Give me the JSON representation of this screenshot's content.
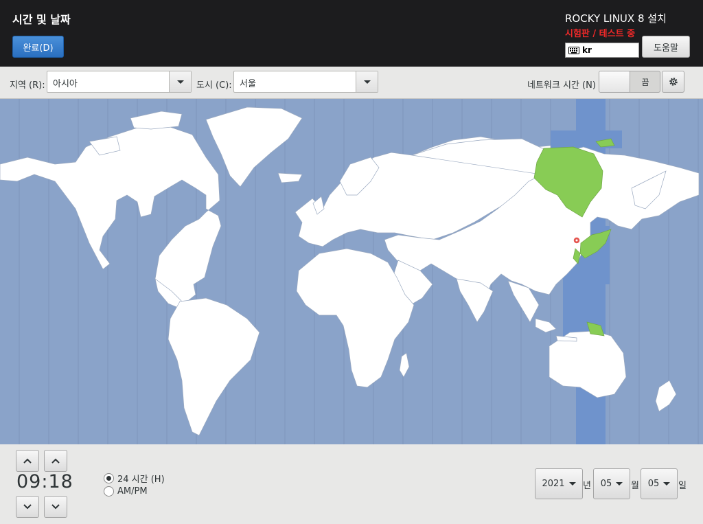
{
  "header": {
    "title": "시간 및 날짜",
    "done_label": "완료(D)",
    "product_title": "ROCKY LINUX 8 설치",
    "beta_label": "시험판 / 테스트 중",
    "keyboard_layout": "kr",
    "help_label": "도움말"
  },
  "toolbar": {
    "region_label": "지역 (R):",
    "region_value": "아시아",
    "city_label": "도시 (C):",
    "city_value": "서울",
    "network_time_label": "네트워크 시간 (N)",
    "network_time_state": "끔"
  },
  "map": {
    "selected_city": "서울",
    "colors": {
      "ocean": "#8aa3c9",
      "land": "#ffffff",
      "selected_zone": "#6f93cc",
      "selected_land": "#88cc55",
      "marker": "#e5554f"
    }
  },
  "time": {
    "hours": "09",
    "minutes": "18",
    "separator": ":",
    "format_24h_label": "24 시간 (H)",
    "format_ampm_label": "AM/PM",
    "selected_format": "24h"
  },
  "date": {
    "year": "2021",
    "year_suffix": "년",
    "month": "05",
    "month_suffix": "월",
    "day": "05",
    "day_suffix": "일"
  },
  "icons": {
    "keyboard": "keyboard-icon",
    "gear": "gear-icon",
    "chevron_up": "chevron-up-icon",
    "chevron_down": "chevron-down-icon",
    "location": "location-pin-icon"
  }
}
